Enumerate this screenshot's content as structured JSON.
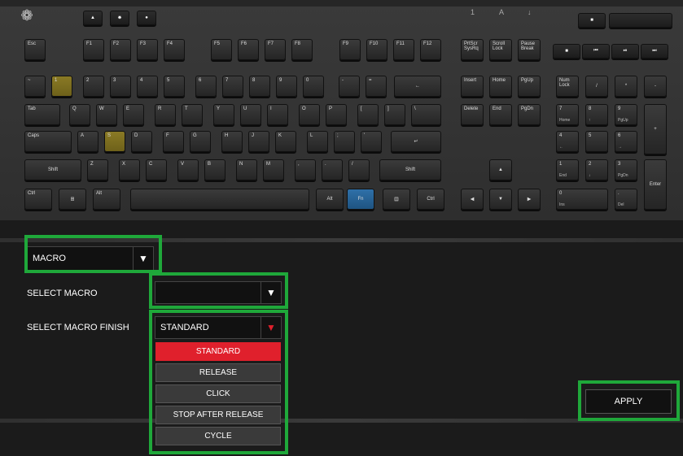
{
  "keyboard": {
    "fn_row": [
      "Esc",
      "F1",
      "F2",
      "F3",
      "F4",
      "F5",
      "F6",
      "F7",
      "F8",
      "F9",
      "F10",
      "F11",
      "F12"
    ],
    "nav_top": [
      "PrtScr SysRq",
      "Scroll Lock",
      "Pause Break"
    ],
    "num_row": [
      "~",
      "1",
      "2",
      "3",
      "4",
      "5",
      "6",
      "7",
      "8",
      "9",
      "0",
      "-",
      "="
    ],
    "tab_row": [
      "Tab",
      "Q",
      "W",
      "E",
      "R",
      "T",
      "Y",
      "U",
      "I",
      "O",
      "P",
      "[",
      "]",
      "\\"
    ],
    "caps_row": [
      "Caps",
      "A",
      "S",
      "D",
      "F",
      "G",
      "H",
      "J",
      "K",
      "L",
      ";",
      "'"
    ],
    "shift_row": [
      "Shift",
      "Z",
      "X",
      "C",
      "V",
      "B",
      "N",
      "M",
      ",",
      ".",
      "/",
      "Shift"
    ],
    "bottom_row": [
      "Ctrl",
      "Alt",
      "Alt",
      "Fn",
      "Ctrl"
    ],
    "nav1": [
      "Insert",
      "Home",
      "PgUp"
    ],
    "nav2": [
      "Delete",
      "End",
      "PgDn"
    ],
    "numpad": [
      "Num Lock",
      "/",
      "*",
      "-",
      "7",
      "8",
      "9",
      "+",
      "4",
      "5",
      "6",
      "1",
      "2",
      "3",
      "Enter",
      "0",
      ".",
      "Home",
      "PgUp",
      "End",
      "PgDn",
      "Ins",
      "Del"
    ]
  },
  "panel": {
    "mode_value": "MACRO",
    "select_macro_label": "SELECT MACRO",
    "select_macro_value": "",
    "select_finish_label": "SELECT MACRO FINISH",
    "select_finish_value": "STANDARD",
    "finish_options": [
      "STANDARD",
      "RELEASE",
      "CLICK",
      "STOP AFTER RELEASE",
      "CYCLE"
    ],
    "apply_label": "APPLY"
  },
  "colors": {
    "highlight": "#1fa83a",
    "selected": "#e0202c",
    "macro_key": "#8a7a25",
    "fn_key": "#2f70a8"
  }
}
